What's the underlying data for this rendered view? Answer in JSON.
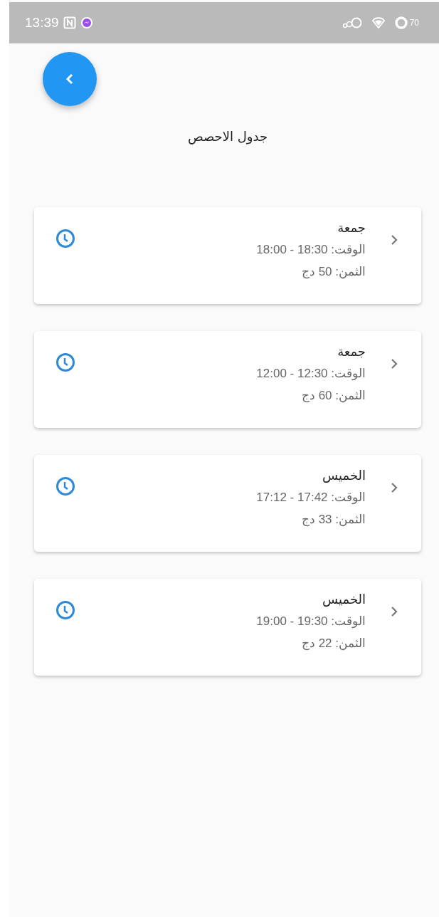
{
  "status_bar": {
    "time": "13:39",
    "battery": "70"
  },
  "title": "جدول الاحصص",
  "sessions": [
    {
      "day": "جمعة",
      "time": "الوقت: 18:30 - 18:00",
      "price": "الثمن: 50 دج"
    },
    {
      "day": "جمعة",
      "time": "الوقت: 12:30 - 12:00",
      "price": "الثمن: 60 دج"
    },
    {
      "day": "الخميس",
      "time": "الوقت: 17:42 - 17:12",
      "price": "الثمن: 33 دج"
    },
    {
      "day": "الخميس",
      "time": "الوقت: 19:30 - 19:00",
      "price": "الثمن: 22 دج"
    }
  ]
}
